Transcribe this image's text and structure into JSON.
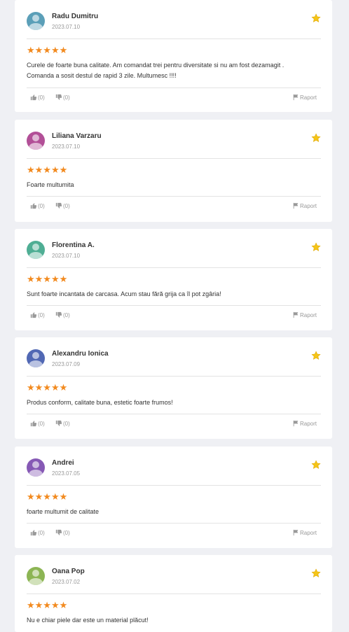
{
  "reviews": [
    {
      "name": "Radu Dumitru",
      "date": "2023.07.10",
      "stars": "★★★★★",
      "text": "Curele de foarte buna calitate. Am comandat trei pentru diversitate si nu am fost dezamagit . Comanda a sosit destul de rapid 3 zile. Multumesc !!!!",
      "likes": "(0)",
      "dislikes": "(0)",
      "report": "Raport",
      "avatar_color": "#5b9fb8"
    },
    {
      "name": "Liliana Varzaru",
      "date": "2023.07.10",
      "stars": "★★★★★",
      "text": "Foarte multumita",
      "likes": "(0)",
      "dislikes": "(0)",
      "report": "Raport",
      "avatar_color": "#b24f97"
    },
    {
      "name": "Florentina A.",
      "date": "2023.07.10",
      "stars": "★★★★★",
      "text": "Sunt foarte incantata de carcasa. Acum stau fără grija ca îl pot zgâria!",
      "likes": "(0)",
      "dislikes": "(0)",
      "report": "Raport",
      "avatar_color": "#4fae94"
    },
    {
      "name": "Alexandru Ionica",
      "date": "2023.07.09",
      "stars": "★★★★★",
      "text": "Produs conform, calitate buna, estetic foarte frumos!",
      "likes": "(0)",
      "dislikes": "(0)",
      "report": "Raport",
      "avatar_color": "#5168b4"
    },
    {
      "name": "Andrei",
      "date": "2023.07.05",
      "stars": "★★★★★",
      "text": "foarte multumit de calitate",
      "likes": "(0)",
      "dislikes": "(0)",
      "report": "Raport",
      "avatar_color": "#8659b5"
    },
    {
      "name": "Oana Pop",
      "date": "2023.07.02",
      "stars": "★★★★★",
      "text": "Nu e chiar piele dar este un material plăcut!",
      "likes": "(0)",
      "dislikes": "(0)",
      "report": "Raport",
      "avatar_color": "#8cb554"
    }
  ],
  "colors": {
    "star": "#f28a1f",
    "favorite_star": "#f5c518",
    "muted": "#999999"
  }
}
